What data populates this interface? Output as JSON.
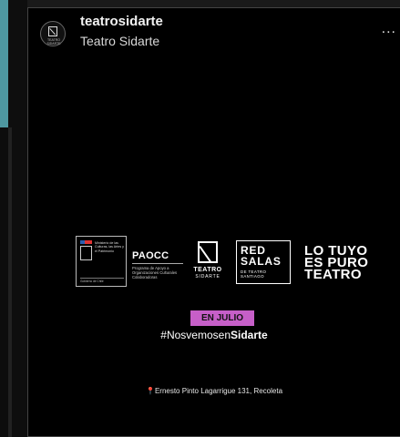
{
  "post": {
    "username": "teatrosidarte",
    "full_name": "Teatro Sidarte",
    "avatar_text": "TEATRO SIDARTE",
    "more_icon": "more-options-icon",
    "more_label": "..."
  },
  "logos": {
    "gov": {
      "text": "Ministerio de las Culturas, las Artes y el Patrimonio",
      "footer": "Gobierno de Chile"
    },
    "paocc": {
      "title": "PAOCC",
      "subtitle": "Programa de Apoyo a Organizaciones Culturales Colaboradoras"
    },
    "teatro_sidarte": {
      "word": "TEATRO",
      "sub": "SIDARTE"
    },
    "red_salas": {
      "line1": "RED",
      "line2": "SALAS",
      "line3": "DE TEATRO SANTIAGO"
    },
    "lo_tuyo": [
      "LO TUYO",
      "ES PURO",
      "TEATRO"
    ]
  },
  "announcement": {
    "badge": "EN JULIO",
    "hashtag_prefix": "#Nosvemosen",
    "hashtag_bold": "Sidarte",
    "badge_color": "#c65fc8"
  },
  "location": {
    "icon": "map-pin-icon",
    "address": "Ernesto Pinto Lagarrigue 131, Recoleta"
  }
}
